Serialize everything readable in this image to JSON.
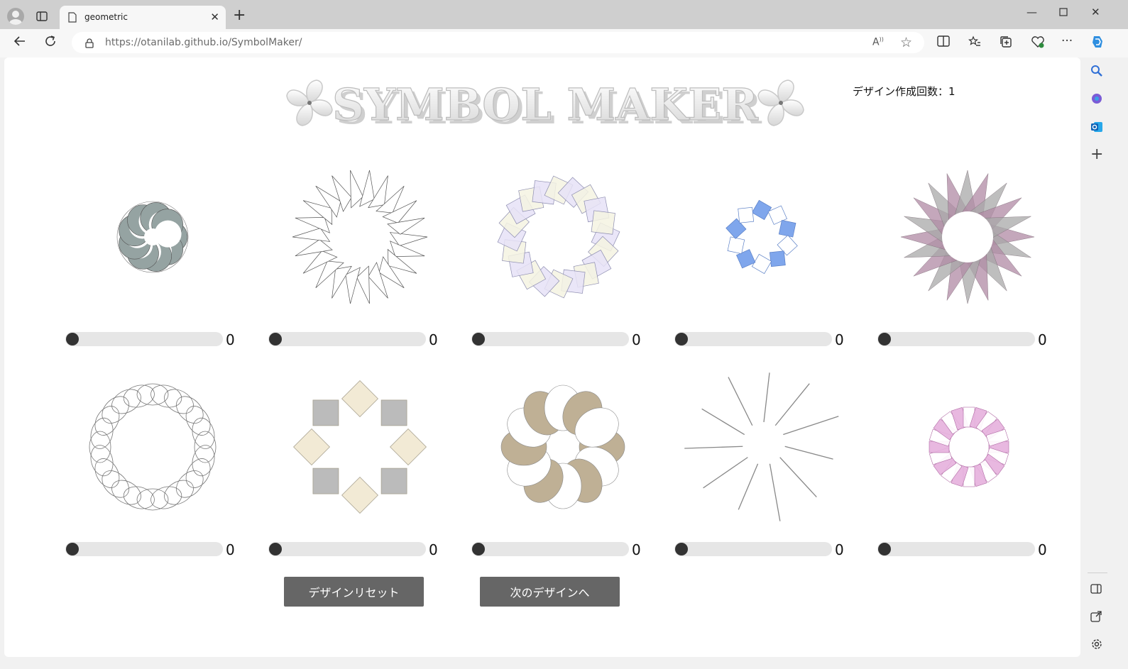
{
  "browser": {
    "tab_title": "geometric",
    "url_host": "https://otanilab.github.io",
    "url_path": "/SymbolMaker/"
  },
  "page": {
    "logo_text": "SYMBOL MAKER",
    "counter_label": "デザイン作成回数：1"
  },
  "symbols": [
    {
      "name": "crescent-swirl",
      "slider_value": 0,
      "colors": [
        "#95a3a2",
        "#ffffff"
      ]
    },
    {
      "name": "star-triangles",
      "slider_value": 0,
      "colors": [
        "#ffffff",
        "#555555"
      ]
    },
    {
      "name": "square-ring",
      "slider_value": 0,
      "colors": [
        "#e6e2f7",
        "#f4f3e2"
      ]
    },
    {
      "name": "blue-squares",
      "slider_value": 0,
      "colors": [
        "#7fa6ec",
        "#ffffff"
      ]
    },
    {
      "name": "mauve-star",
      "slider_value": 0,
      "colors": [
        "#b08aa4",
        "#a8a8a8"
      ]
    },
    {
      "name": "ellipse-ring",
      "slider_value": 0,
      "colors": [
        "#ffffff",
        "#777777"
      ]
    },
    {
      "name": "octagon-squares",
      "slider_value": 0,
      "colors": [
        "#f2ead5",
        "#bbbbbb"
      ]
    },
    {
      "name": "ellipse-flower",
      "slider_value": 0,
      "colors": [
        "#bfb095",
        "#ffffff"
      ]
    },
    {
      "name": "line-burst",
      "slider_value": 0,
      "colors": [
        "#888888"
      ]
    },
    {
      "name": "pink-ring",
      "slider_value": 0,
      "colors": [
        "#e6b0dd",
        "#ffffff"
      ]
    }
  ],
  "buttons": {
    "reset_label": "デザインリセット",
    "next_label": "次のデザインへ"
  }
}
